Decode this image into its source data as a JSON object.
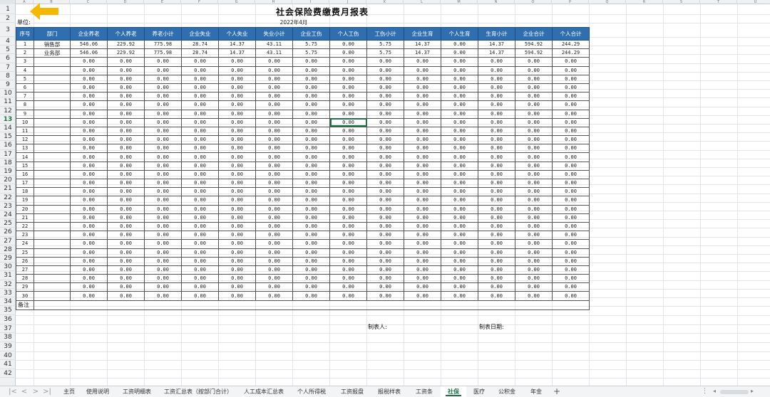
{
  "sheet": {
    "title": "社会保险费缴费月报表",
    "period": "2022年4月",
    "unit_label": "单位:",
    "remark_label": "备注",
    "preparer_label": "制表人:",
    "date_label": "制表日期:"
  },
  "column_letters": [
    "A",
    "B",
    "C",
    "D",
    "E",
    "F",
    "G",
    "H",
    "I",
    "J",
    "K",
    "L",
    "M",
    "N",
    "O",
    "P",
    "Q",
    "R",
    "S",
    "T",
    "U"
  ],
  "table": {
    "headers": [
      "序号",
      "部门",
      "企业养老",
      "个人养老",
      "养老小计",
      "企业失业",
      "个人失业",
      "失业小计",
      "企业工伤",
      "个人工伤",
      "工伤小计",
      "企业生育",
      "个人生育",
      "生育小计",
      "企业合计",
      "个人合计"
    ],
    "rows": [
      [
        "1",
        "销售部",
        "546.06",
        "229.92",
        "775.98",
        "28.74",
        "14.37",
        "43.11",
        "5.75",
        "0.00",
        "5.75",
        "14.37",
        "0.00",
        "14.37",
        "594.92",
        "244.29"
      ],
      [
        "2",
        "业务部",
        "546.06",
        "229.92",
        "775.98",
        "28.74",
        "14.37",
        "43.11",
        "5.75",
        "0.00",
        "5.75",
        "14.37",
        "0.00",
        "14.37",
        "594.92",
        "244.29"
      ],
      [
        "3",
        "",
        "0.00",
        "0.00",
        "0.00",
        "0.00",
        "0.00",
        "0.00",
        "0.00",
        "0.00",
        "0.00",
        "0.00",
        "0.00",
        "0.00",
        "0.00",
        "0.00"
      ],
      [
        "4",
        "",
        "0.00",
        "0.00",
        "0.00",
        "0.00",
        "0.00",
        "0.00",
        "0.00",
        "0.00",
        "0.00",
        "0.00",
        "0.00",
        "0.00",
        "0.00",
        "0.00"
      ],
      [
        "5",
        "",
        "0.00",
        "0.00",
        "0.00",
        "0.00",
        "0.00",
        "0.00",
        "0.00",
        "0.00",
        "0.00",
        "0.00",
        "0.00",
        "0.00",
        "0.00",
        "0.00"
      ],
      [
        "6",
        "",
        "0.00",
        "0.00",
        "0.00",
        "0.00",
        "0.00",
        "0.00",
        "0.00",
        "0.00",
        "0.00",
        "0.00",
        "0.00",
        "0.00",
        "0.00",
        "0.00"
      ],
      [
        "7",
        "",
        "0.00",
        "0.00",
        "0.00",
        "0.00",
        "0.00",
        "0.00",
        "0.00",
        "0.00",
        "0.00",
        "0.00",
        "0.00",
        "0.00",
        "0.00",
        "0.00"
      ],
      [
        "8",
        "",
        "0.00",
        "0.00",
        "0.00",
        "0.00",
        "0.00",
        "0.00",
        "0.00",
        "0.00",
        "0.00",
        "0.00",
        "0.00",
        "0.00",
        "0.00",
        "0.00"
      ],
      [
        "9",
        "",
        "0.00",
        "0.00",
        "0.00",
        "0.00",
        "0.00",
        "0.00",
        "0.00",
        "0.00",
        "0.00",
        "0.00",
        "0.00",
        "0.00",
        "0.00",
        "0.00"
      ],
      [
        "10",
        "",
        "0.00",
        "0.00",
        "0.00",
        "0.00",
        "0.00",
        "0.00",
        "0.00",
        "0.00",
        "0.00",
        "0.00",
        "0.00",
        "0.00",
        "0.00",
        "0.00"
      ],
      [
        "11",
        "",
        "0.00",
        "0.00",
        "0.00",
        "0.00",
        "0.00",
        "0.00",
        "0.00",
        "0.00",
        "0.00",
        "0.00",
        "0.00",
        "0.00",
        "0.00",
        "0.00"
      ],
      [
        "12",
        "",
        "0.00",
        "0.00",
        "0.00",
        "0.00",
        "0.00",
        "0.00",
        "0.00",
        "0.00",
        "0.00",
        "0.00",
        "0.00",
        "0.00",
        "0.00",
        "0.00"
      ],
      [
        "13",
        "",
        "0.00",
        "0.00",
        "0.00",
        "0.00",
        "0.00",
        "0.00",
        "0.00",
        "0.00",
        "0.00",
        "0.00",
        "0.00",
        "0.00",
        "0.00",
        "0.00"
      ],
      [
        "14",
        "",
        "0.00",
        "0.00",
        "0.00",
        "0.00",
        "0.00",
        "0.00",
        "0.00",
        "0.00",
        "0.00",
        "0.00",
        "0.00",
        "0.00",
        "0.00",
        "0.00"
      ],
      [
        "15",
        "",
        "0.00",
        "0.00",
        "0.00",
        "0.00",
        "0.00",
        "0.00",
        "0.00",
        "0.00",
        "0.00",
        "0.00",
        "0.00",
        "0.00",
        "0.00",
        "0.00"
      ],
      [
        "16",
        "",
        "0.00",
        "0.00",
        "0.00",
        "0.00",
        "0.00",
        "0.00",
        "0.00",
        "0.00",
        "0.00",
        "0.00",
        "0.00",
        "0.00",
        "0.00",
        "0.00"
      ],
      [
        "17",
        "",
        "0.00",
        "0.00",
        "0.00",
        "0.00",
        "0.00",
        "0.00",
        "0.00",
        "0.00",
        "0.00",
        "0.00",
        "0.00",
        "0.00",
        "0.00",
        "0.00"
      ],
      [
        "18",
        "",
        "0.00",
        "0.00",
        "0.00",
        "0.00",
        "0.00",
        "0.00",
        "0.00",
        "0.00",
        "0.00",
        "0.00",
        "0.00",
        "0.00",
        "0.00",
        "0.00"
      ],
      [
        "19",
        "",
        "0.00",
        "0.00",
        "0.00",
        "0.00",
        "0.00",
        "0.00",
        "0.00",
        "0.00",
        "0.00",
        "0.00",
        "0.00",
        "0.00",
        "0.00",
        "0.00"
      ],
      [
        "20",
        "",
        "0.00",
        "0.00",
        "0.00",
        "0.00",
        "0.00",
        "0.00",
        "0.00",
        "0.00",
        "0.00",
        "0.00",
        "0.00",
        "0.00",
        "0.00",
        "0.00"
      ],
      [
        "21",
        "",
        "0.00",
        "0.00",
        "0.00",
        "0.00",
        "0.00",
        "0.00",
        "0.00",
        "0.00",
        "0.00",
        "0.00",
        "0.00",
        "0.00",
        "0.00",
        "0.00"
      ],
      [
        "22",
        "",
        "0.00",
        "0.00",
        "0.00",
        "0.00",
        "0.00",
        "0.00",
        "0.00",
        "0.00",
        "0.00",
        "0.00",
        "0.00",
        "0.00",
        "0.00",
        "0.00"
      ],
      [
        "23",
        "",
        "0.00",
        "0.00",
        "0.00",
        "0.00",
        "0.00",
        "0.00",
        "0.00",
        "0.00",
        "0.00",
        "0.00",
        "0.00",
        "0.00",
        "0.00",
        "0.00"
      ],
      [
        "24",
        "",
        "0.00",
        "0.00",
        "0.00",
        "0.00",
        "0.00",
        "0.00",
        "0.00",
        "0.00",
        "0.00",
        "0.00",
        "0.00",
        "0.00",
        "0.00",
        "0.00"
      ],
      [
        "25",
        "",
        "0.00",
        "0.00",
        "0.00",
        "0.00",
        "0.00",
        "0.00",
        "0.00",
        "0.00",
        "0.00",
        "0.00",
        "0.00",
        "0.00",
        "0.00",
        "0.00"
      ],
      [
        "26",
        "",
        "0.00",
        "0.00",
        "0.00",
        "0.00",
        "0.00",
        "0.00",
        "0.00",
        "0.00",
        "0.00",
        "0.00",
        "0.00",
        "0.00",
        "0.00",
        "0.00"
      ],
      [
        "27",
        "",
        "0.00",
        "0.00",
        "0.00",
        "0.00",
        "0.00",
        "0.00",
        "0.00",
        "0.00",
        "0.00",
        "0.00",
        "0.00",
        "0.00",
        "0.00",
        "0.00"
      ],
      [
        "28",
        "",
        "0.00",
        "0.00",
        "0.00",
        "0.00",
        "0.00",
        "0.00",
        "0.00",
        "0.00",
        "0.00",
        "0.00",
        "0.00",
        "0.00",
        "0.00",
        "0.00"
      ],
      [
        "29",
        "",
        "0.00",
        "0.00",
        "0.00",
        "0.00",
        "0.00",
        "0.00",
        "0.00",
        "0.00",
        "0.00",
        "0.00",
        "0.00",
        "0.00",
        "0.00",
        "0.00"
      ],
      [
        "30",
        "",
        "0.00",
        "0.00",
        "0.00",
        "0.00",
        "0.00",
        "0.00",
        "0.00",
        "0.00",
        "0.00",
        "0.00",
        "0.00",
        "0.00",
        "0.00",
        "0.00"
      ]
    ]
  },
  "row_numbers": [
    "1",
    "2",
    "3",
    "4",
    "5",
    "6",
    "7",
    "8",
    "9",
    "10",
    "11",
    "12",
    "13",
    "14",
    "15",
    "16",
    "17",
    "18",
    "19",
    "20",
    "21",
    "22",
    "23",
    "24",
    "25",
    "26",
    "27",
    "28",
    "29",
    "30",
    "31",
    "32",
    "33",
    "34",
    "35",
    "36",
    "37",
    "38",
    "39",
    "40",
    "41",
    "42"
  ],
  "active_row": "13",
  "sheet_tabs": [
    {
      "label": "主页"
    },
    {
      "label": "使用说明"
    },
    {
      "label": "工资明细表"
    },
    {
      "label": "工资汇总表（按部门合计）"
    },
    {
      "label": "人工成本汇总表"
    },
    {
      "label": "个人所得税"
    },
    {
      "label": "工资报盘"
    },
    {
      "label": "报税样表"
    },
    {
      "label": "工资条"
    },
    {
      "label": "社保",
      "active": true
    },
    {
      "label": "医疗"
    },
    {
      "label": "公积金"
    },
    {
      "label": "年金"
    }
  ],
  "colors": {
    "header_fill": "#2f6fb0",
    "selection": "#217346",
    "arrow": "#f5b800"
  },
  "icons": {
    "nav_first": "first-sheet-icon",
    "nav_prev": "prev-sheet-icon",
    "nav_next": "next-sheet-icon",
    "nav_last": "last-sheet-icon",
    "add_sheet": "plus-icon",
    "arrow": "left-arrow-icon"
  }
}
